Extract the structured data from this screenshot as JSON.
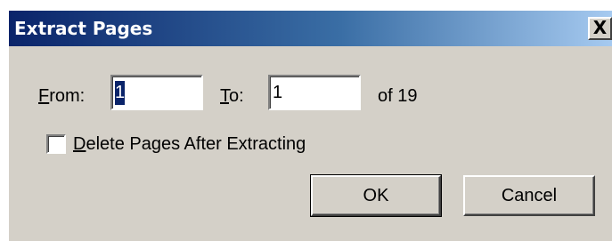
{
  "dialog": {
    "title": "Extract Pages",
    "close_label": "X",
    "from": {
      "label_mnemonic": "F",
      "label_rest": "rom:",
      "value": "1"
    },
    "to": {
      "label_mnemonic": "T",
      "label_rest": "o:",
      "value": "1"
    },
    "of_total": "of 19",
    "delete_option": {
      "mnemonic": "D",
      "rest": "elete Pages After Extracting",
      "checked": false
    },
    "ok_label": "OK",
    "cancel_label": "Cancel"
  },
  "colors": {
    "title_start": "#0a246a",
    "title_end": "#a6caf0",
    "face": "#d4d0c8",
    "selection": "#0a246a"
  }
}
